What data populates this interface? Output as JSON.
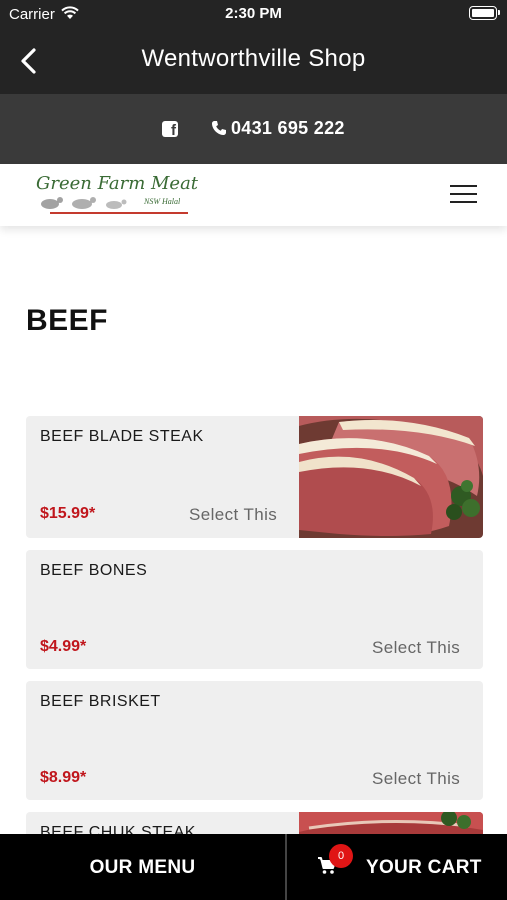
{
  "status_bar": {
    "carrier": "Carrier",
    "time": "2:30 PM"
  },
  "nav": {
    "title": "Wentworthville Shop"
  },
  "contact": {
    "phone": "0431 695 222"
  },
  "logo": {
    "name": "Green Farm Meat",
    "sub": "NSW Halal"
  },
  "page": {
    "title": "BEEF"
  },
  "products": [
    {
      "name": "BEEF BLADE STEAK",
      "price": "$15.99*",
      "action": "Select This"
    },
    {
      "name": "BEEF BONES",
      "price": "$4.99*",
      "action": "Select This"
    },
    {
      "name": "BEEF BRISKET",
      "price": "$8.99*",
      "action": "Select This"
    },
    {
      "name": "BEEF CHUK STEAK"
    }
  ],
  "bottom_bar": {
    "menu_label": "OUR MENU",
    "cart_label": "YOUR CART",
    "cart_count": "0"
  },
  "colors": {
    "header_dark": "#242424",
    "contact_bar": "#3a3a3a",
    "price_red": "#c0161c",
    "badge_red": "#e01515",
    "card_bg": "#efefef"
  }
}
